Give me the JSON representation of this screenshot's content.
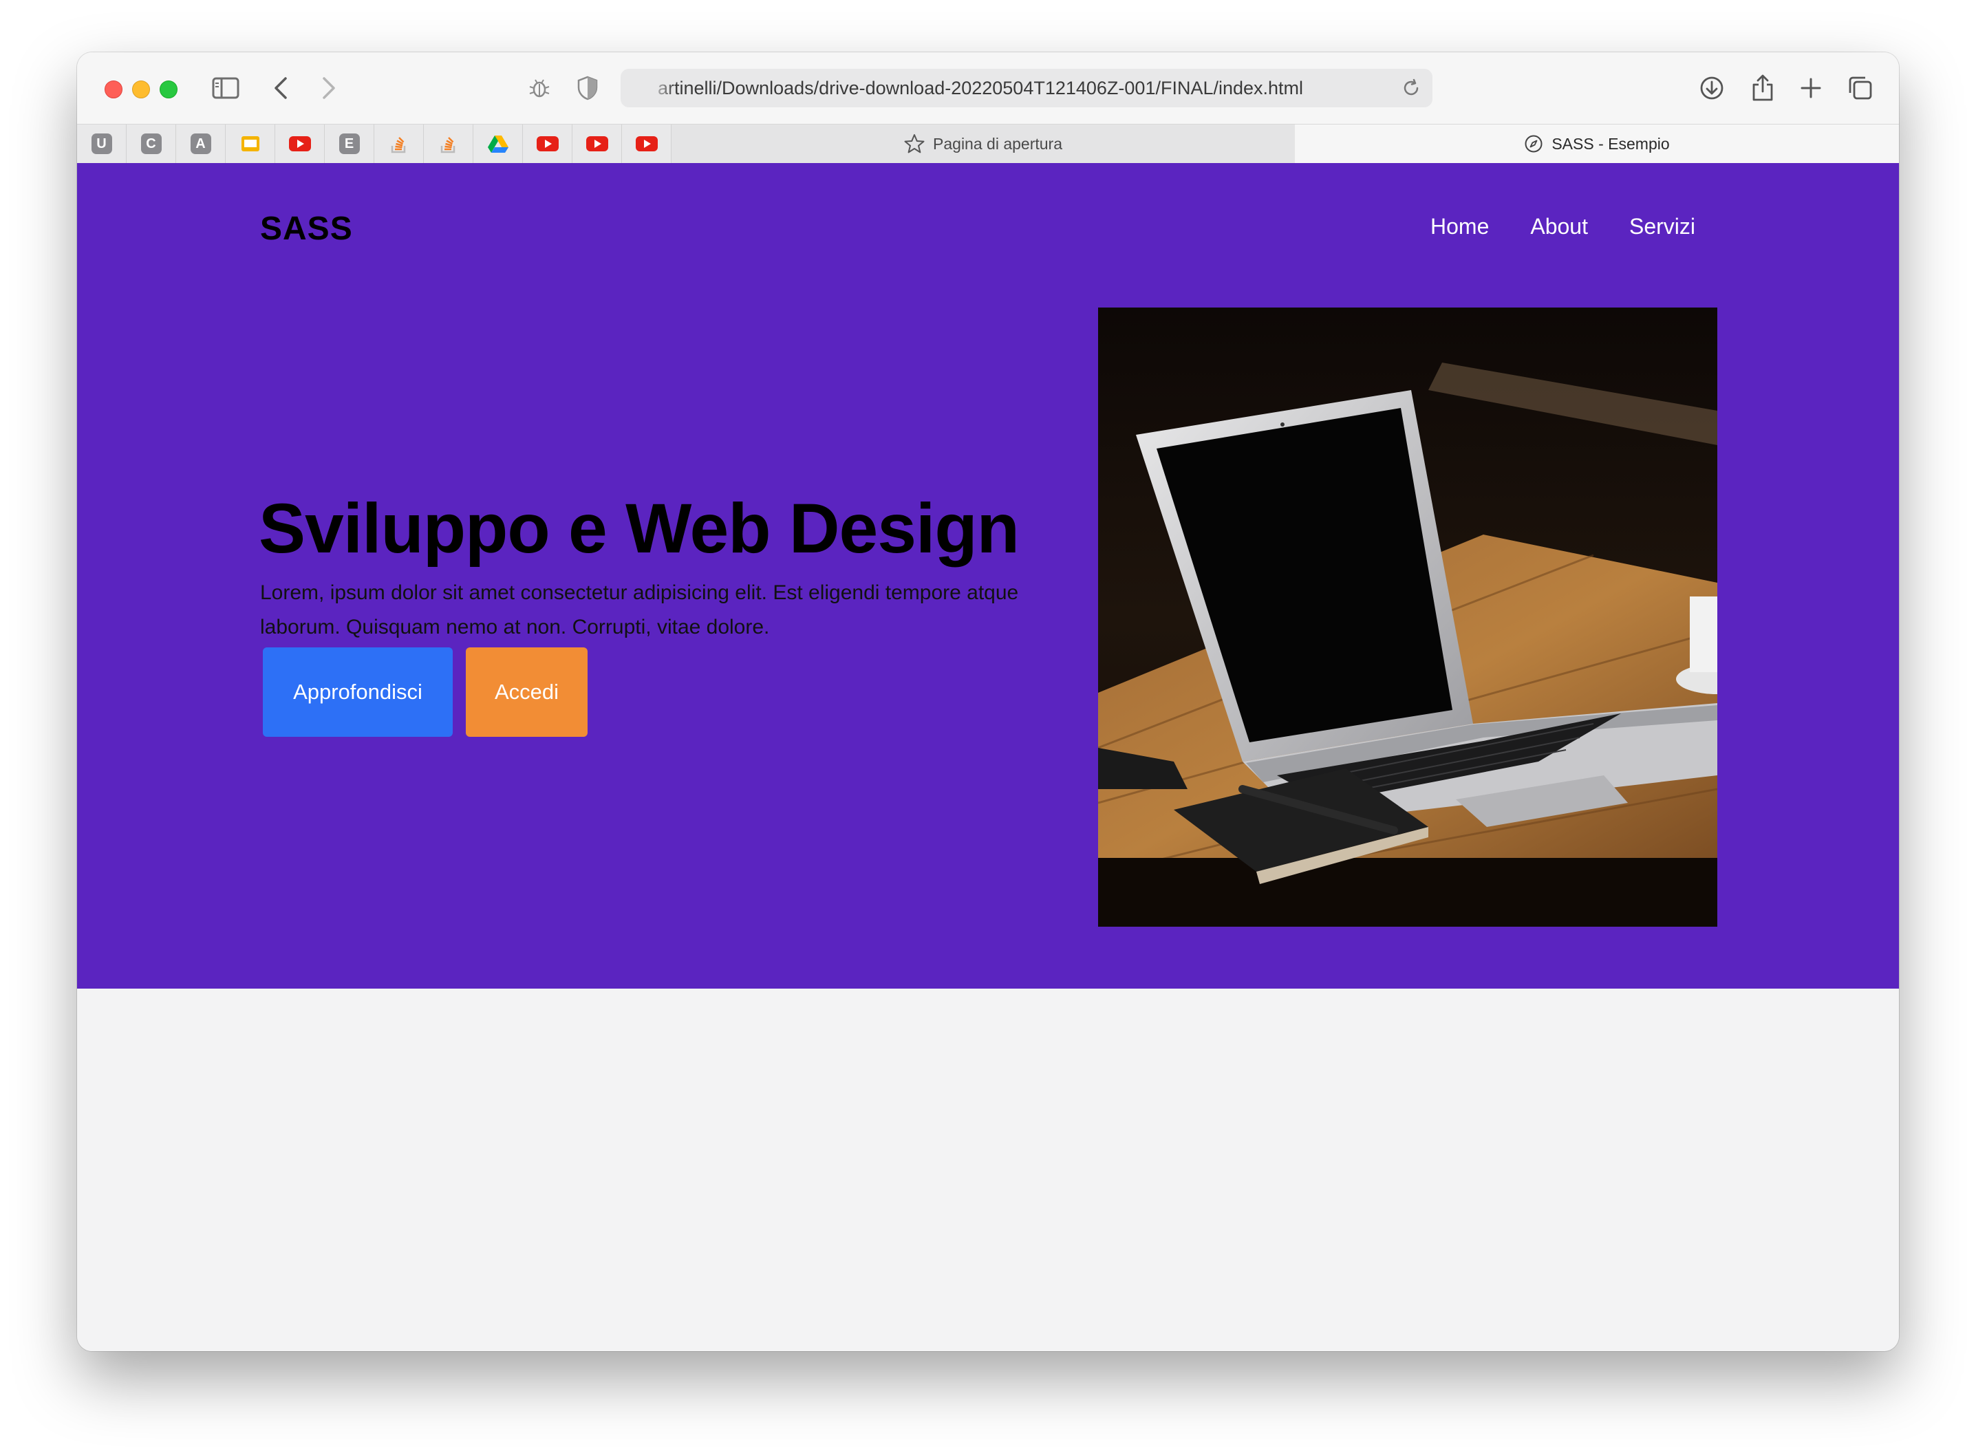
{
  "browser": {
    "url": "artinelli/Downloads/drive-download-20220504T121406Z-001/FINAL/index.html",
    "favorites": [
      {
        "kind": "letter",
        "letter": "U"
      },
      {
        "kind": "letter",
        "letter": "C"
      },
      {
        "kind": "letter",
        "letter": "A"
      },
      {
        "kind": "slides"
      },
      {
        "kind": "youtube"
      },
      {
        "kind": "letter",
        "letter": "E"
      },
      {
        "kind": "stack"
      },
      {
        "kind": "stack"
      },
      {
        "kind": "drive"
      },
      {
        "kind": "youtube"
      },
      {
        "kind": "youtube"
      },
      {
        "kind": "youtube"
      }
    ],
    "tabs": [
      {
        "title": "Pagina di apertura",
        "active": false
      },
      {
        "title": "SASS - Esempio",
        "active": true
      }
    ]
  },
  "page": {
    "logo": "SASS",
    "nav": [
      "Home",
      "About",
      "Servizi"
    ],
    "hero": {
      "title": "Sviluppo e Web Design",
      "text_line1": "Lorem, ipsum dolor sit amet consectetur adipisicing elit. Est eligendi tempore atque",
      "text_line2": "laborum. Quisquam nemo at non. Corrupti, vitae dolore.",
      "primary_button": "Approfondisci",
      "secondary_button": "Accedi"
    },
    "colors": {
      "hero_bg": "#5b24c0",
      "primary_button": "#2d70f6",
      "secondary_button": "#f28d35",
      "page_bg": "#f3f3f4"
    }
  }
}
